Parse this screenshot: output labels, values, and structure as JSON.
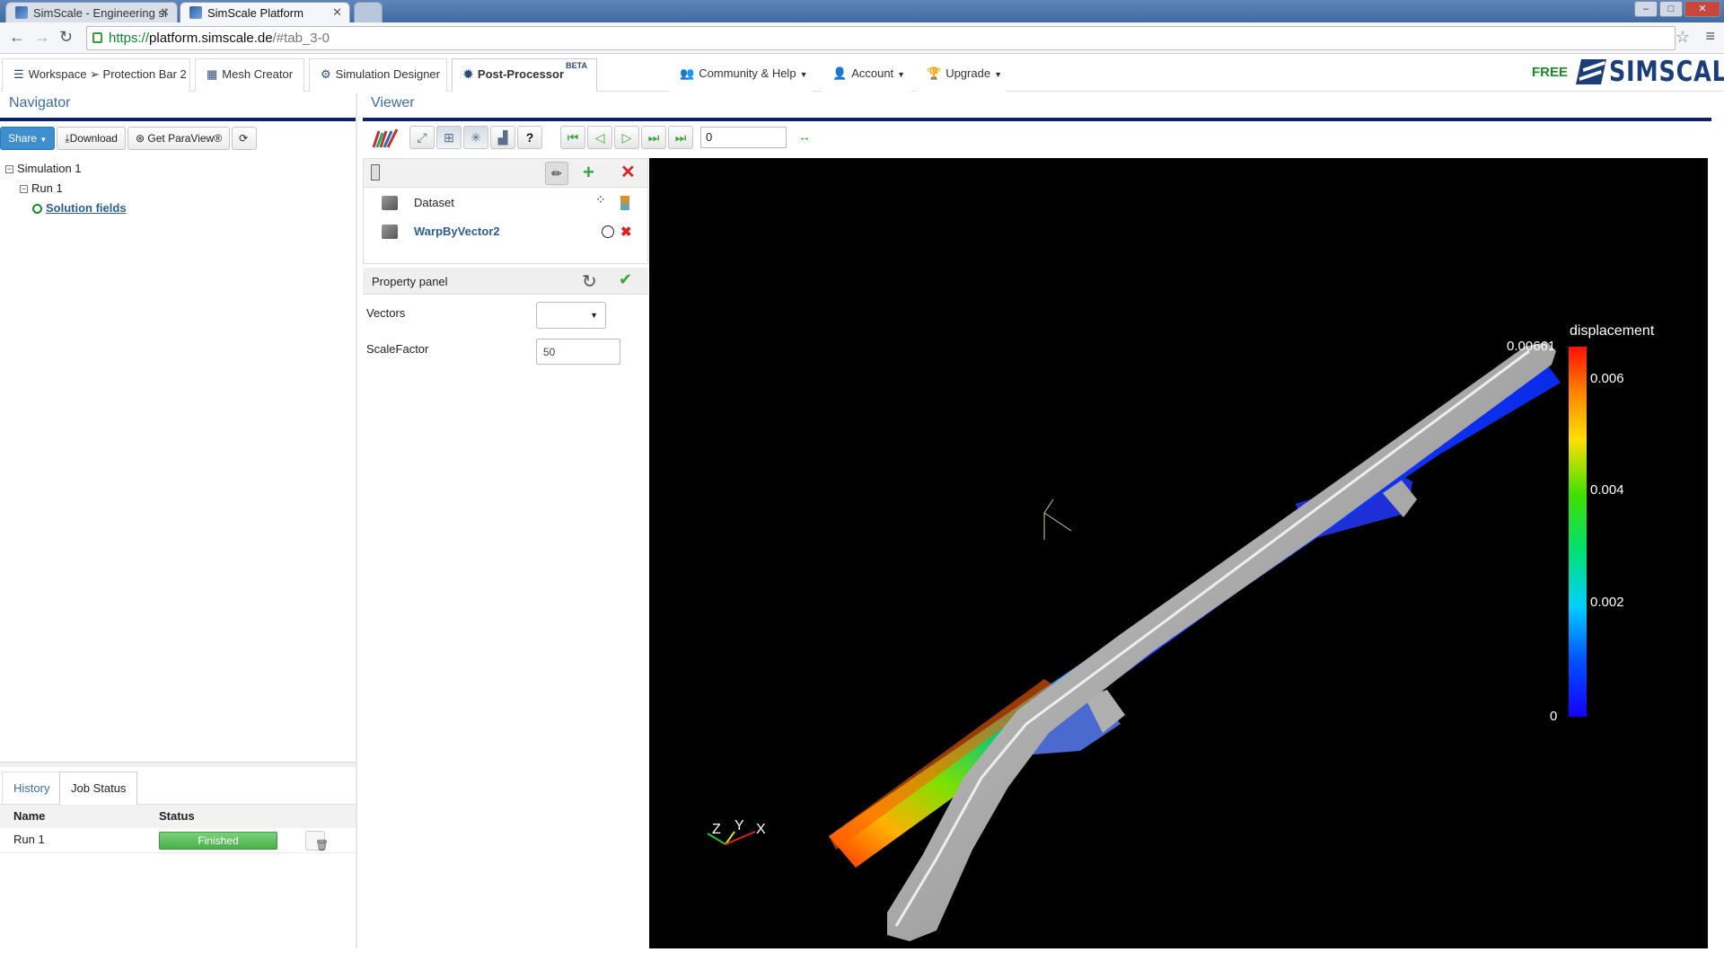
{
  "browser": {
    "tabs": [
      {
        "label": "SimScale - Engineering si"
      },
      {
        "label": "SimScale Platform"
      }
    ],
    "url": {
      "protocol": "https://",
      "host": "platform.simscale.de",
      "path": "/#tab_3-0"
    }
  },
  "appnav": {
    "tabs": [
      {
        "label": "Workspace ➢ Protection Bar 2"
      },
      {
        "label": "Mesh Creator"
      },
      {
        "label": "Simulation Designer"
      },
      {
        "label": "Post-Processor",
        "badge": "BETA"
      }
    ],
    "menus": [
      {
        "label": "Community & Help"
      },
      {
        "label": "Account"
      },
      {
        "label": "Upgrade"
      }
    ],
    "plan": "FREE",
    "logo_text": "SIMSCALE"
  },
  "navigator": {
    "title": "Navigator",
    "buttons": {
      "share": "Share",
      "download": "Download",
      "paraview": "Get ParaView®"
    },
    "tree": {
      "simulation": "Simulation 1",
      "run": "Run 1",
      "solution": "Solution fields"
    }
  },
  "jobs": {
    "tabs": {
      "history": "History",
      "job_status": "Job Status"
    },
    "columns": {
      "name": "Name",
      "status": "Status"
    },
    "rows": [
      {
        "name": "Run 1",
        "status": "Finished"
      }
    ]
  },
  "viewer": {
    "title": "Viewer",
    "frame_value": "0",
    "pipeline": [
      {
        "name": "Dataset"
      },
      {
        "name": "WarpByVector2"
      }
    ],
    "property_panel": {
      "title": "Property panel",
      "vectors_label": "Vectors",
      "scale_label": "ScaleFactor",
      "scale_value": "50"
    },
    "legend": {
      "title": "displacement",
      "max": "0.00661",
      "ticks": [
        "0.006",
        "0.004",
        "0.002",
        "0"
      ]
    },
    "axes": {
      "z": "Z",
      "y": "Y",
      "x": "X"
    }
  },
  "colors": {
    "accent": "#0c1f6a",
    "brand": "#1b3e78",
    "ok": "#49b049"
  }
}
